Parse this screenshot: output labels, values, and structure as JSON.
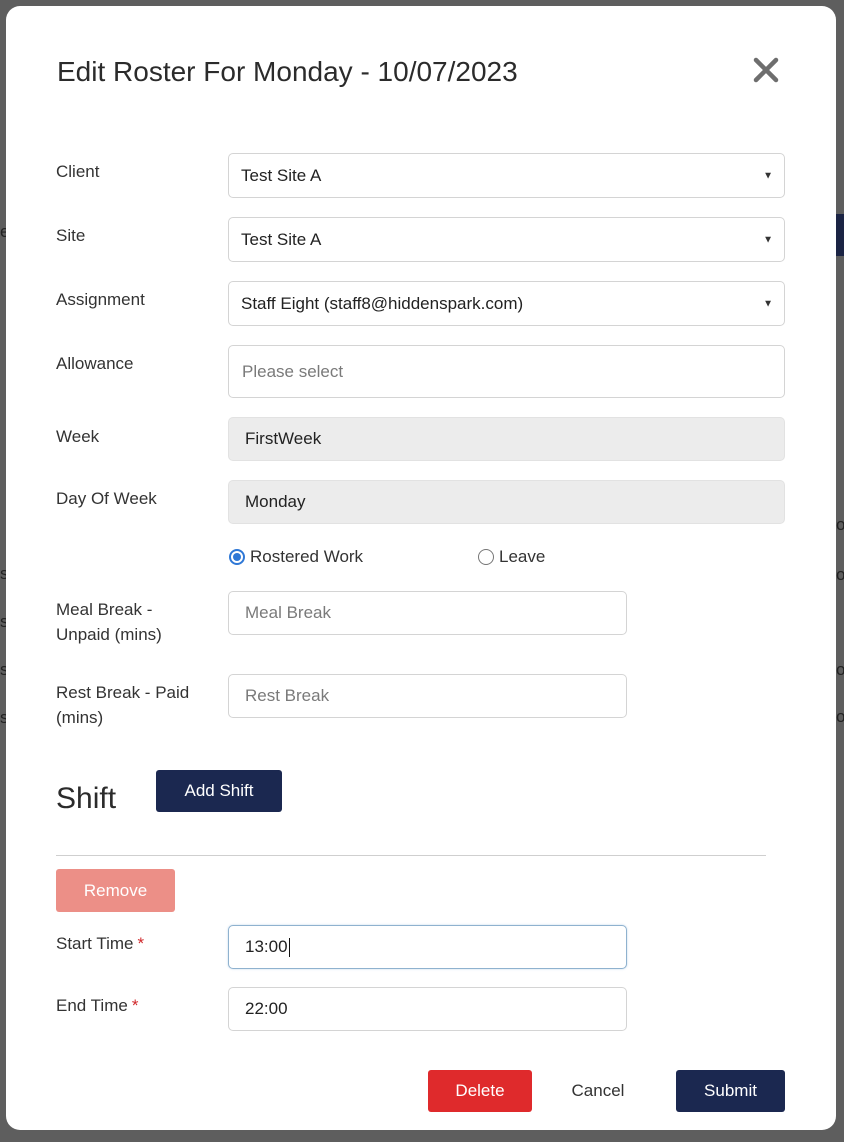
{
  "background": {
    "fragments": [
      "e",
      "s",
      "s",
      "s",
      "s",
      "o",
      "o",
      "o",
      "o"
    ]
  },
  "modal": {
    "title": "Edit Roster For Monday - 10/07/2023"
  },
  "form": {
    "client": {
      "label": "Client",
      "value": "Test Site A"
    },
    "site": {
      "label": "Site",
      "value": "Test Site A"
    },
    "assignment": {
      "label": "Assignment",
      "value": "Staff Eight (staff8@hiddenspark.com)"
    },
    "allowance": {
      "label": "Allowance",
      "placeholder": "Please select"
    },
    "week": {
      "label": "Week",
      "value": "FirstWeek"
    },
    "day_of_week": {
      "label": "Day Of Week",
      "value": "Monday"
    },
    "work_type": {
      "options": [
        "Rostered Work",
        "Leave"
      ],
      "selected": "Rostered Work"
    },
    "meal_break": {
      "label_line1": "Meal Break -",
      "label_line2": "Unpaid (mins)",
      "placeholder": "Meal Break"
    },
    "rest_break": {
      "label_line1": "Rest Break - Paid",
      "label_line2": "(mins)",
      "placeholder": "Rest Break"
    }
  },
  "shift": {
    "title": "Shift",
    "add_label": "Add Shift",
    "remove_label": "Remove",
    "start_time": {
      "label": "Start Time",
      "required_mark": "*",
      "value": "13:00"
    },
    "end_time": {
      "label": "End Time",
      "required_mark": "*",
      "value": "22:00"
    }
  },
  "footer": {
    "delete_label": "Delete",
    "cancel_label": "Cancel",
    "submit_label": "Submit"
  },
  "colors": {
    "primary": "#1b2850",
    "danger": "#df2a2c",
    "danger_light": "#ec8f87",
    "radio_accent": "#2f78d6"
  }
}
